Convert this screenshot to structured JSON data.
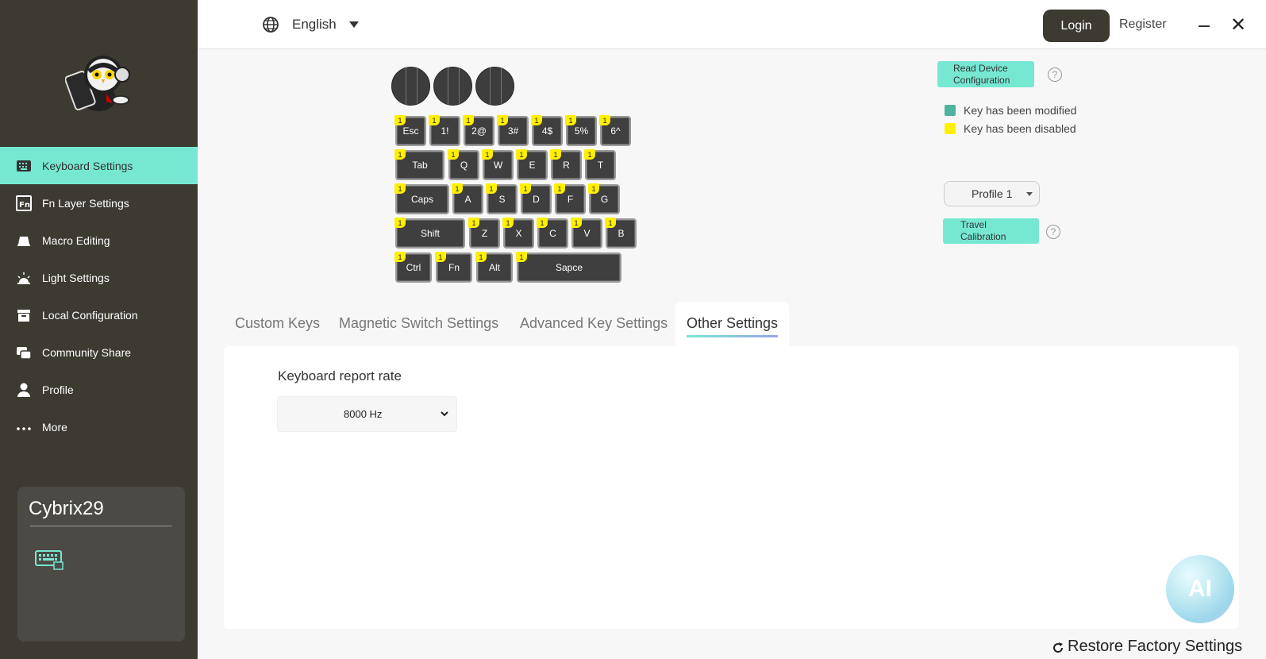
{
  "sidebar": {
    "items": [
      {
        "label": "Keyboard Settings",
        "icon": "keyboard-icon",
        "active": true
      },
      {
        "label": "Fn Layer Settings",
        "icon": "fn-icon",
        "active": false
      },
      {
        "label": "Macro Editing",
        "icon": "macro-icon",
        "active": false
      },
      {
        "label": "Light Settings",
        "icon": "light-icon",
        "active": false
      },
      {
        "label": "Local Configuration",
        "icon": "archive-icon",
        "active": false
      },
      {
        "label": "Community Share",
        "icon": "chat-icon",
        "active": false
      },
      {
        "label": "Profile",
        "icon": "user-icon",
        "active": false
      },
      {
        "label": "More",
        "icon": "more-icon",
        "active": false
      }
    ],
    "device": {
      "name": "Cybrix29"
    }
  },
  "topbar": {
    "language": "English",
    "login": "Login",
    "register": "Register"
  },
  "keyboard": {
    "layer_badge": "1",
    "rows": [
      [
        "Esc",
        "1!",
        "2@",
        "3#",
        "4$",
        "5%",
        "6^"
      ],
      [
        "Tab",
        "Q",
        "W",
        "E",
        "R",
        "T"
      ],
      [
        "Caps",
        "A",
        "S",
        "D",
        "F",
        "G"
      ],
      [
        "Shift",
        "Z",
        "X",
        "C",
        "V",
        "B"
      ],
      [
        "Ctrl",
        "Fn",
        "Alt",
        "Sapce"
      ]
    ]
  },
  "controls": {
    "read_device": "Read Device Configuration",
    "legend_modified": "Key has been modified",
    "legend_disabled": "Key has been disabled",
    "profile": "Profile 1",
    "travel_calibration": "Travel Calibration",
    "help": "?"
  },
  "tabs": [
    {
      "label": "Custom Keys",
      "active": false
    },
    {
      "label": "Magnetic Switch Settings",
      "active": false
    },
    {
      "label": "Advanced Key Settings",
      "active": false
    },
    {
      "label": "Other Settings",
      "active": true
    }
  ],
  "panel": {
    "report_rate_label": "Keyboard report rate",
    "report_rate_value": "8000 Hz",
    "ai_label": "AI"
  },
  "footer": {
    "restore": "Restore Factory Settings"
  },
  "colors": {
    "accent": "#76e8d2",
    "sidebar_bg": "#3c3a31",
    "modified": "#4fb39e",
    "disabled": "#ffef00"
  }
}
